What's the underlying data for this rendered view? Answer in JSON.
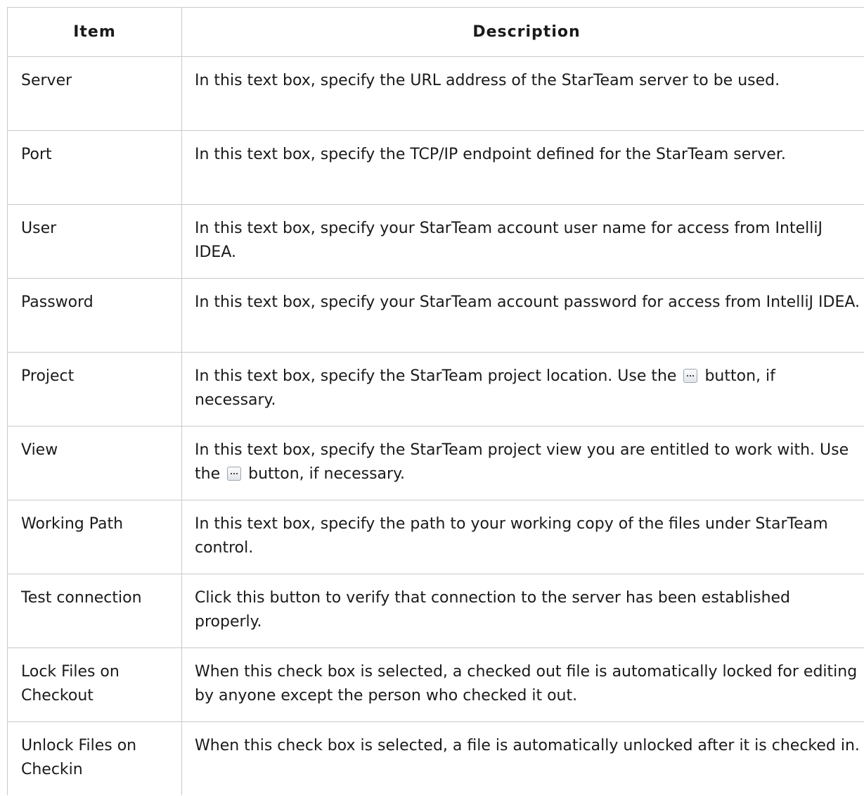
{
  "table": {
    "headers": {
      "item": "Item",
      "description": "Description"
    },
    "rows": [
      {
        "item": "Server",
        "description": "In this text box, specify the URL address of the StarTeam server to be used."
      },
      {
        "item": "Port",
        "description": "In this text box, specify the TCP/IP endpoint defined for the StarTeam server."
      },
      {
        "item": "User",
        "description": "In this text box, specify your StarTeam account user name for access from IntelliJ IDEA."
      },
      {
        "item": "Password",
        "description": "In this text box, specify your StarTeam account password for access from IntelliJ IDEA."
      },
      {
        "item": "Project",
        "description_before": "In this text box, specify the StarTeam project location. Use the",
        "description_after": "button, if necessary.",
        "inline_icon": "ellipsis-button-icon"
      },
      {
        "item": "View",
        "description_before": "In this text box, specify the StarTeam project view you are entitled to work with. Use the",
        "description_after": "button, if necessary.",
        "inline_icon": "ellipsis-button-icon"
      },
      {
        "item": "Working Path",
        "description": "In this text box, specify the path to your working copy of the files under StarTeam control."
      },
      {
        "item": "Test connection",
        "description": "Click this button to verify that connection to the server has been established properly."
      },
      {
        "item": "Lock Files on Checkout",
        "description": "When this check box is selected, a checked out file is automatically locked for editing by anyone except the person who checked it out."
      },
      {
        "item": "Unlock Files on Checkin",
        "description": "When this check box is selected, a file is automatically unlocked after it is checked in."
      }
    ]
  }
}
